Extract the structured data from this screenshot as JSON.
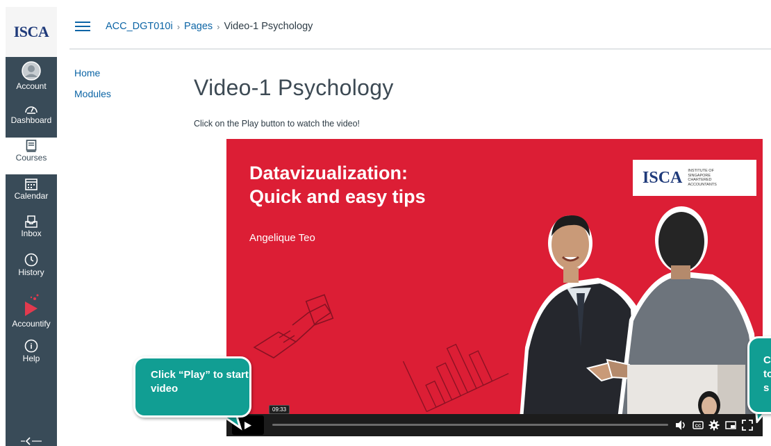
{
  "global_nav": {
    "logo": "ISCA",
    "items": [
      {
        "label": "Account",
        "icon": "account-icon"
      },
      {
        "label": "Dashboard",
        "icon": "dashboard-icon"
      },
      {
        "label": "Courses",
        "icon": "courses-icon",
        "active": true
      },
      {
        "label": "Calendar",
        "icon": "calendar-icon"
      },
      {
        "label": "Inbox",
        "icon": "inbox-icon"
      },
      {
        "label": "History",
        "icon": "history-icon"
      },
      {
        "label": "Accountify",
        "icon": "accountify-icon"
      },
      {
        "label": "Help",
        "icon": "help-icon"
      }
    ]
  },
  "header": {
    "breadcrumb": [
      "ACC_DGT010i",
      "Pages",
      "Video-1 Psychology"
    ]
  },
  "course_nav": {
    "items": [
      "Home",
      "Modules"
    ]
  },
  "main": {
    "title": "Video-1 Psychology",
    "instructions": "Click on the Play button to watch the video!"
  },
  "video": {
    "title_lines": [
      "Datavizualization:",
      "Quick and easy tips"
    ],
    "presenter": "Angelique Teo",
    "logo_text": "ISCA",
    "logo_subtext": "Institute of Singapore Chartered Accountants",
    "time": "09:33",
    "progress": 0.0
  },
  "callouts": {
    "play": "Click “Play” to start video",
    "fullscreen": "C\nto\ns"
  },
  "colors": {
    "nav_bg": "#394b58",
    "link": "#0b64a5",
    "video_bg": "#dc1e35",
    "callout": "#119e93"
  }
}
